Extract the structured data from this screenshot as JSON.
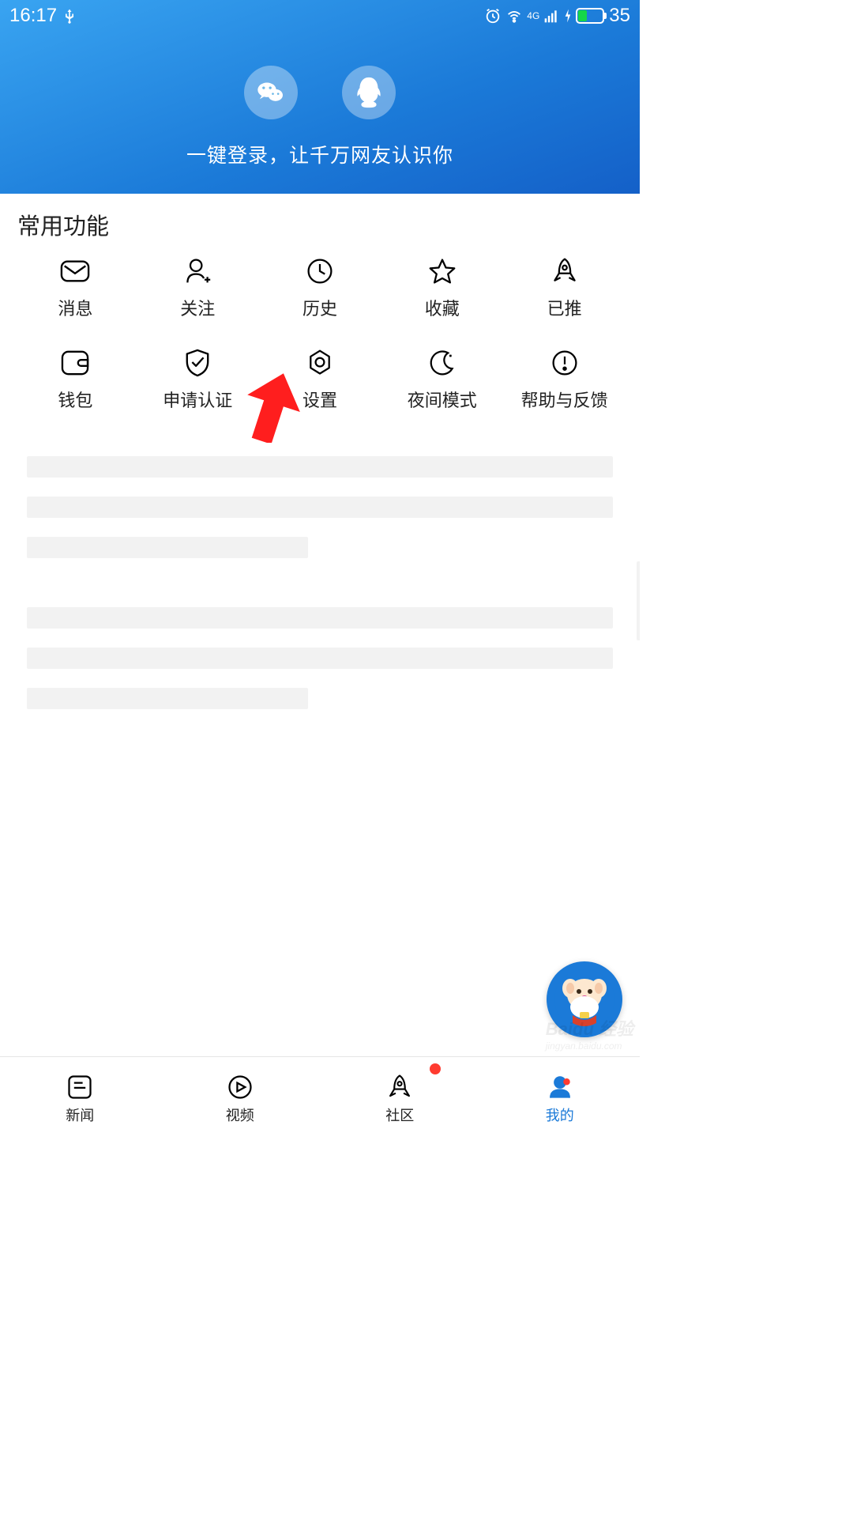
{
  "status": {
    "time": "16:17",
    "battery_text": "35"
  },
  "header": {
    "prompt": "一键登录，让千万网友认识你"
  },
  "section": {
    "title": "常用功能"
  },
  "grid": {
    "items": [
      {
        "label": "消息"
      },
      {
        "label": "关注"
      },
      {
        "label": "历史"
      },
      {
        "label": "收藏"
      },
      {
        "label": "已推"
      },
      {
        "label": "钱包"
      },
      {
        "label": "申请认证"
      },
      {
        "label": "设置"
      },
      {
        "label": "夜间模式"
      },
      {
        "label": "帮助与反馈"
      }
    ]
  },
  "tabs": {
    "items": [
      {
        "label": "新闻"
      },
      {
        "label": "视频"
      },
      {
        "label": "社区"
      },
      {
        "label": "我的"
      }
    ]
  },
  "watermark": {
    "brand": "Baidu 经验",
    "domain": "jingyan.baidu.com"
  }
}
